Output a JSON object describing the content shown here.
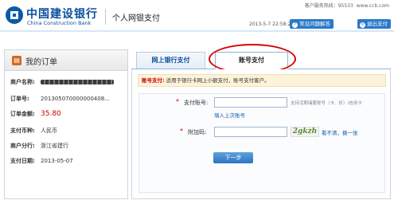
{
  "header": {
    "bank_name_cn": "中国建设银行",
    "bank_name_en": "China Construction Bank",
    "service_title": "个人网银支付",
    "hotline": "客户服务热线：95533",
    "website": "www.ccb.com",
    "datetime": "2013-5-7 22:58:22",
    "faq_label": "常见问题解答",
    "exit_label": "退出支付"
  },
  "order": {
    "title": "我的订单",
    "rows": [
      {
        "label": "商户名称:",
        "value": ""
      },
      {
        "label": "订单号:",
        "value": "201305070000000408..."
      },
      {
        "label": "订单金额:",
        "value": "35.80"
      },
      {
        "label": "支付币种:",
        "value": "人民币"
      },
      {
        "label": "商户分行:",
        "value": "浙江省建行"
      },
      {
        "label": "支付日期:",
        "value": "2013-05-07"
      }
    ]
  },
  "tabs": [
    {
      "label": "网上银行支付",
      "active": false
    },
    {
      "label": "账号支付",
      "active": true
    }
  ],
  "tip": {
    "label": "账号支付:",
    "text": " 适用于银行卡网上小额支付，账号支付客户。"
  },
  "form": {
    "account_label": "支付账号:",
    "account_value": "",
    "account_hint": "支持活期储蓄账号（卡、折）/信用卡",
    "last_account_link": "填入上次账号",
    "code_label": "附加码:",
    "code_value": "",
    "captcha_text": "2gkzh",
    "refresh_link": "看不清，换一张",
    "next_label": "下一步"
  },
  "colors": {
    "brand_blue": "#0a4f9c",
    "accent_red": "#cc0000",
    "button_blue": "#2b78c9",
    "highlight_ellipse": "#d80000"
  }
}
